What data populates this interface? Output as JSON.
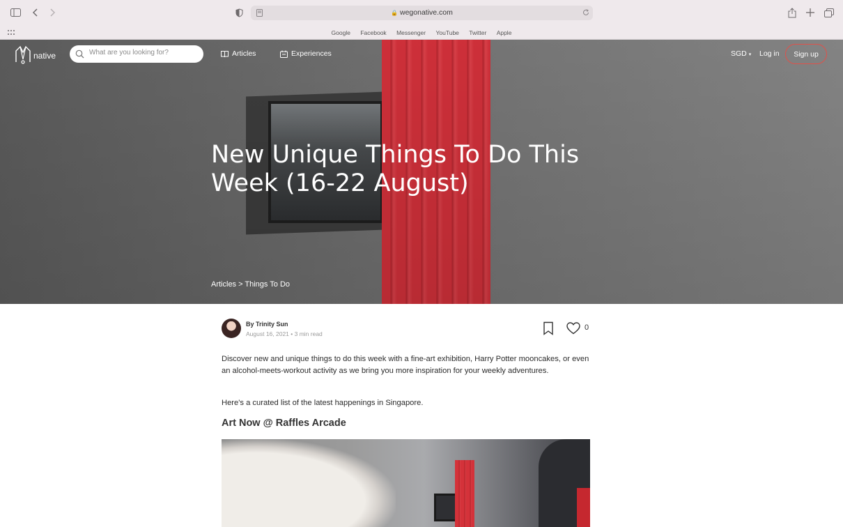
{
  "browser": {
    "url": "wegonative.com",
    "favorites": [
      "Google",
      "Facebook",
      "Messenger",
      "YouTube",
      "Twitter",
      "Apple"
    ]
  },
  "site": {
    "logo_text": "native",
    "search_placeholder": "What are you looking for?",
    "nav": {
      "articles": "Articles",
      "experiences": "Experiences"
    },
    "currency": "SGD",
    "login": "Log in",
    "signup": "Sign up",
    "accent": "#e0514a"
  },
  "hero": {
    "title": "New Unique Things To Do This Week (16-22 August)",
    "breadcrumb": "Articles > Things To Do"
  },
  "article": {
    "author": "By Trinity Sun",
    "meta": "August 16, 2021 • 3 min read",
    "likes": "0",
    "intro": "Discover new and unique things to do this week with a fine-art exhibition, Harry Potter mooncakes, or even an alcohol-meets-workout activity as we bring you more inspiration for your weekly adventures.",
    "curated": "Here's a curated list of the latest happenings in Singapore.",
    "section_title": "Art Now @ Raffles Arcade"
  }
}
